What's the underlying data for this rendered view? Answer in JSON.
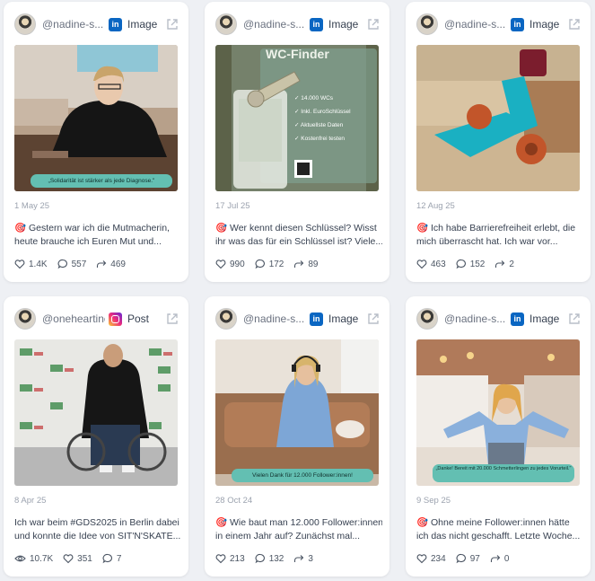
{
  "cards": [
    {
      "handle": "@nadine-s...",
      "platform_icon": "linkedin-icon",
      "type": "Image",
      "date": "1 May 25",
      "text_lines": [
        "🎯 Gestern war ich die Mutmacherin,",
        "heute brauche ich Euren Mut und..."
      ],
      "banner": "„Solidarität ist stärker als jede Diagnose.\"",
      "stats": [
        {
          "icon": "heart-icon",
          "value": "1.4K"
        },
        {
          "icon": "comment-icon",
          "value": "557"
        },
        {
          "icon": "share-icon",
          "value": "469"
        }
      ]
    },
    {
      "handle": "@nadine-s...",
      "platform_icon": "linkedin-icon",
      "type": "Image",
      "date": "17 Jul 25",
      "text_lines": [
        "🎯 Wer kennt diesen Schlüssel? Wisst",
        "ihr was das für ein Schlüssel ist? Viele..."
      ],
      "media_texts": {
        "title": "WC-Finder",
        "bullets": [
          "14.000 WCs",
          "Inkl. EuroSchlüssel",
          "Aktuellste Daten",
          "Kostenfrei testen"
        ]
      },
      "stats": [
        {
          "icon": "heart-icon",
          "value": "990"
        },
        {
          "icon": "comment-icon",
          "value": "172"
        },
        {
          "icon": "share-icon",
          "value": "89"
        }
      ]
    },
    {
      "handle": "@nadine-s...",
      "platform_icon": "linkedin-icon",
      "type": "Image",
      "date": "12 Aug 25",
      "text_lines": [
        "🎯 Ich habe Barrierefreiheit erlebt, die",
        "mich überrascht hat. Ich war vor..."
      ],
      "stats": [
        {
          "icon": "heart-icon",
          "value": "463"
        },
        {
          "icon": "comment-icon",
          "value": "152"
        },
        {
          "icon": "share-icon",
          "value": "2"
        }
      ]
    },
    {
      "handle": "@oneheartinc...",
      "platform_icon": "instagram-icon",
      "type": "Post",
      "date": "8 Apr 25",
      "text_lines": [
        "Ich war beim #GDS2025 in Berlin dabei",
        "und konnte die Idee von SIT'N'SKATE..."
      ],
      "stats": [
        {
          "icon": "eye-icon",
          "value": "10.7K"
        },
        {
          "icon": "heart-icon",
          "value": "351"
        },
        {
          "icon": "comment-icon",
          "value": "7"
        }
      ]
    },
    {
      "handle": "@nadine-s...",
      "platform_icon": "linkedin-icon",
      "type": "Image",
      "date": "28 Oct 24",
      "text_lines": [
        "🎯 Wie baut man 12.000 Follower:innen",
        "in einem Jahr auf? Zunächst mal..."
      ],
      "banner": "Vielen Dank für 12.000 Follower:innen!",
      "stats": [
        {
          "icon": "heart-icon",
          "value": "213"
        },
        {
          "icon": "comment-icon",
          "value": "132"
        },
        {
          "icon": "share-icon",
          "value": "3"
        }
      ]
    },
    {
      "handle": "@nadine-s...",
      "platform_icon": "linkedin-icon",
      "type": "Image",
      "date": "9 Sep 25",
      "text_lines": [
        "🎯 Ohne meine Follower:innen hätte",
        "ich das nicht geschafft. Letzte Woche..."
      ],
      "banner": "„Danke! Bereit mit 20.000 Schmetterlingen zu jedes Vorurteil.\"",
      "stats": [
        {
          "icon": "heart-icon",
          "value": "234"
        },
        {
          "icon": "comment-icon",
          "value": "97"
        },
        {
          "icon": "share-icon",
          "value": "0"
        }
      ]
    }
  ],
  "colors": {
    "linkedin": "#0a66c2",
    "banner": "#63bfb2",
    "background": "#eef0f4"
  }
}
